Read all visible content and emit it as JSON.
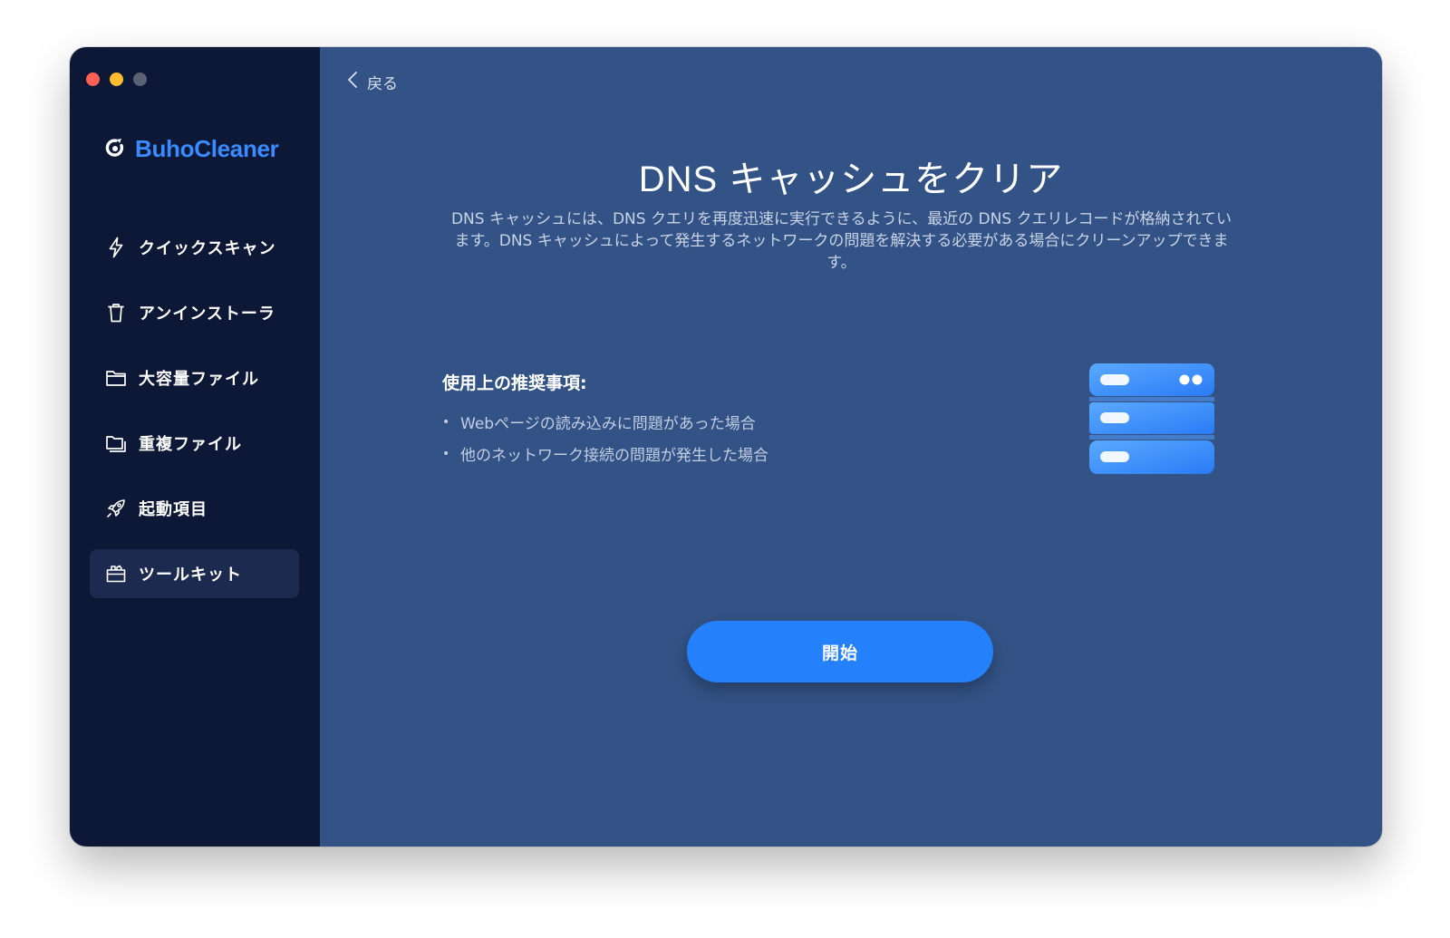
{
  "sidebar": {
    "brand": "BuhoCleaner",
    "items": [
      {
        "label": "クイックスキャン",
        "icon": "lightning-icon"
      },
      {
        "label": "アンインストーラ",
        "icon": "trash-icon"
      },
      {
        "label": "大容量ファイル",
        "icon": "folder-icon"
      },
      {
        "label": "重複ファイル",
        "icon": "duplicate-folder-icon"
      },
      {
        "label": "起動項目",
        "icon": "rocket-icon"
      },
      {
        "label": "ツールキット",
        "icon": "toolbox-icon",
        "active": true
      }
    ]
  },
  "main": {
    "back_label": "戻る",
    "title": "DNS キャッシュをクリア",
    "description": "DNS キャッシュには、DNS クエリを再度迅速に実行できるように、最近の DNS クエリレコードが格納されています。DNS キャッシュによって発生するネットワークの問題を解決する必要がある場合にクリーンアップできます。",
    "recommendations_title": "使用上の推奨事項:",
    "recommendations": [
      "Webページの読み込みに問題があった場合",
      "他のネットワーク接続の問題が発生した場合"
    ],
    "start_label": "開始",
    "illustration": "server-icon"
  },
  "colors": {
    "sidebar_bg": "#0c1836",
    "main_bg": "#335386",
    "accent": "#2481fb",
    "brand": "#3a8bff"
  }
}
